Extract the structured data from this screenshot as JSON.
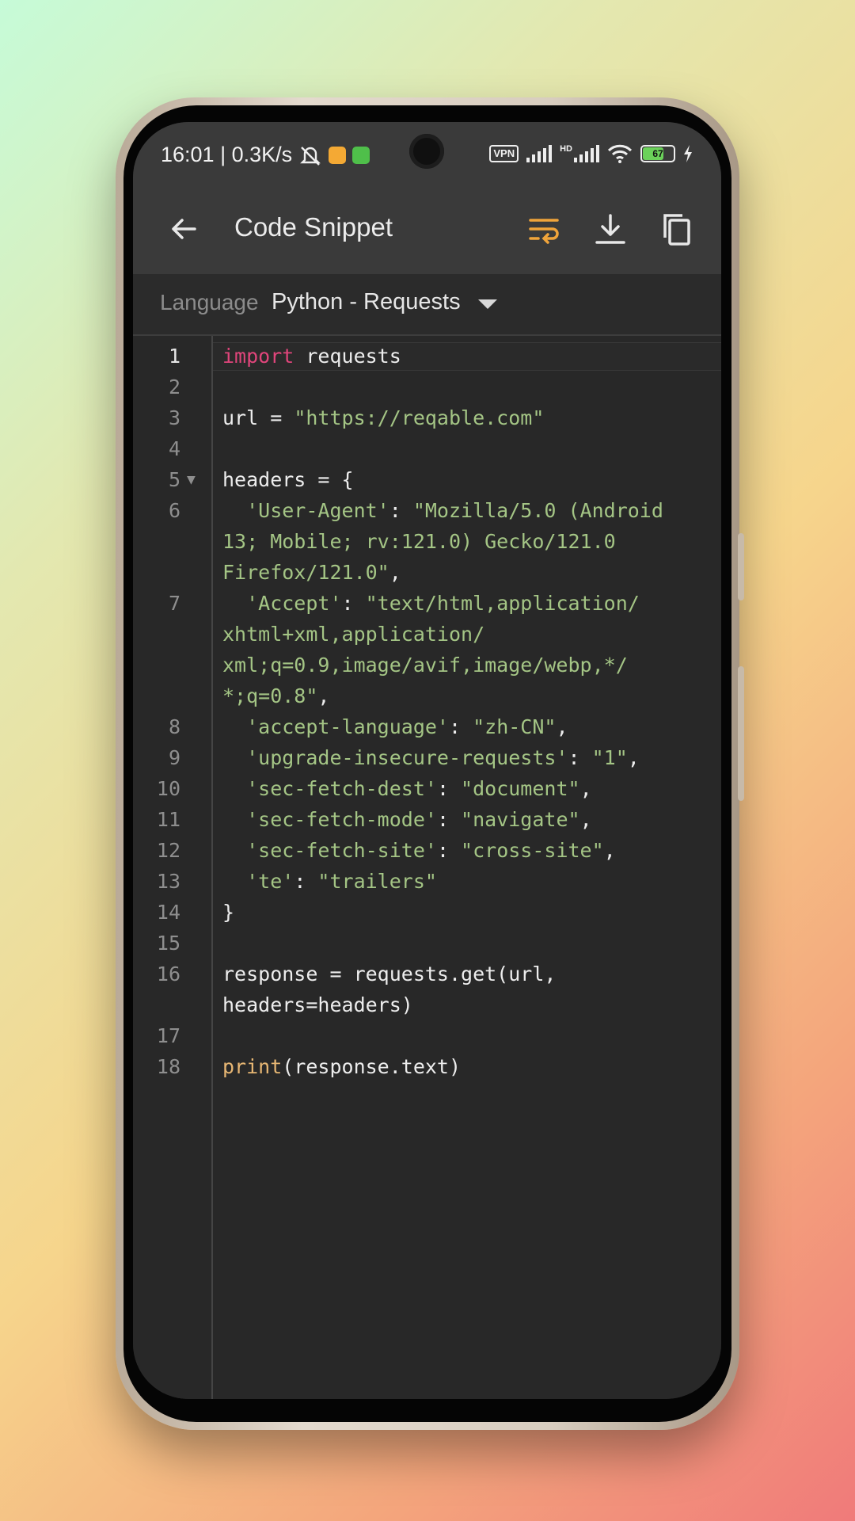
{
  "status": {
    "time_speed": "16:01 | 0.3K/s",
    "vpn": "VPN",
    "network": "HD",
    "battery": "67"
  },
  "appbar": {
    "title": "Code Snippet",
    "accent": "#f0a43a"
  },
  "language": {
    "label": "Language",
    "value": "Python - Requests"
  },
  "editor": {
    "line_numbers": [
      "1",
      "2",
      "3",
      "4",
      "5",
      "6",
      "7",
      "8",
      "9",
      "10",
      "11",
      "12",
      "13",
      "14",
      "15",
      "16",
      "17",
      "18"
    ],
    "lines": [
      {
        "segments": [
          [
            "kw",
            "import"
          ],
          [
            "plain",
            " requests"
          ]
        ]
      },
      {
        "segments": []
      },
      {
        "segments": [
          [
            "plain",
            "url = "
          ],
          [
            "str",
            "\"https://reqable.com\""
          ]
        ]
      },
      {
        "segments": []
      },
      {
        "segments": [
          [
            "plain",
            "headers = {"
          ]
        ]
      },
      {
        "segments": [
          [
            "str",
            "  'User-Agent'"
          ],
          [
            "plain",
            ": "
          ],
          [
            "str",
            "\"Mozilla/5.0 (Android"
          ]
        ]
      },
      {
        "segments": [
          [
            "str",
            "13; Mobile; rv:121.0) Gecko/121.0"
          ]
        ]
      },
      {
        "segments": [
          [
            "str",
            "Firefox/121.0\""
          ],
          [
            "plain",
            ","
          ]
        ]
      },
      {
        "segments": [
          [
            "str",
            "  'Accept'"
          ],
          [
            "plain",
            ": "
          ],
          [
            "str",
            "\"text/html,application/"
          ]
        ]
      },
      {
        "segments": [
          [
            "str",
            "xhtml+xml,application/"
          ]
        ]
      },
      {
        "segments": [
          [
            "str",
            "xml;q=0.9,image/avif,image/webp,*/"
          ]
        ]
      },
      {
        "segments": [
          [
            "str",
            "*;q=0.8\""
          ],
          [
            "plain",
            ","
          ]
        ]
      },
      {
        "segments": [
          [
            "str",
            "  'accept-language'"
          ],
          [
            "plain",
            ": "
          ],
          [
            "str",
            "\"zh-CN\""
          ],
          [
            "plain",
            ","
          ]
        ]
      },
      {
        "segments": [
          [
            "str",
            "  'upgrade-insecure-requests'"
          ],
          [
            "plain",
            ": "
          ],
          [
            "str",
            "\"1\""
          ],
          [
            "plain",
            ","
          ]
        ]
      },
      {
        "segments": [
          [
            "str",
            "  'sec-fetch-dest'"
          ],
          [
            "plain",
            ": "
          ],
          [
            "str",
            "\"document\""
          ],
          [
            "plain",
            ","
          ]
        ]
      },
      {
        "segments": [
          [
            "str",
            "  'sec-fetch-mode'"
          ],
          [
            "plain",
            ": "
          ],
          [
            "str",
            "\"navigate\""
          ],
          [
            "plain",
            ","
          ]
        ]
      },
      {
        "segments": [
          [
            "str",
            "  'sec-fetch-site'"
          ],
          [
            "plain",
            ": "
          ],
          [
            "str",
            "\"cross-site\""
          ],
          [
            "plain",
            ","
          ]
        ]
      },
      {
        "segments": [
          [
            "str",
            "  'te'"
          ],
          [
            "plain",
            ": "
          ],
          [
            "str",
            "\"trailers\""
          ]
        ]
      },
      {
        "segments": [
          [
            "plain",
            "}"
          ]
        ]
      },
      {
        "segments": []
      },
      {
        "segments": [
          [
            "plain",
            "response = requests.get(url,"
          ]
        ]
      },
      {
        "segments": [
          [
            "plain",
            "headers=headers)"
          ]
        ]
      },
      {
        "segments": []
      },
      {
        "segments": [
          [
            "fn",
            "print"
          ],
          [
            "plain",
            "(response.text)"
          ]
        ]
      }
    ]
  }
}
